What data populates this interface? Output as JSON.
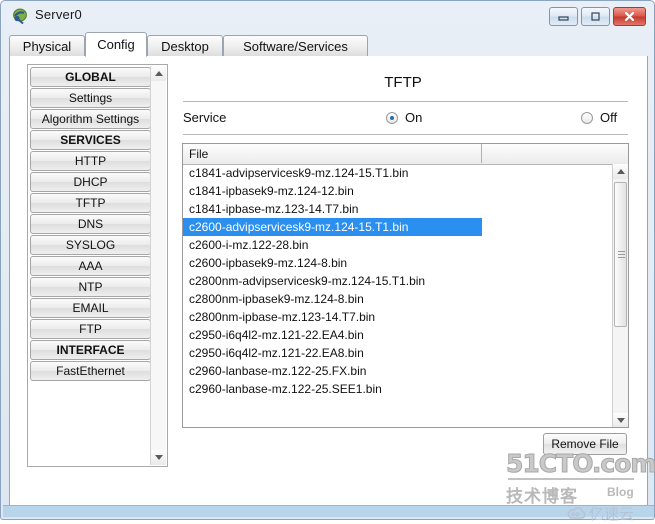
{
  "window": {
    "title": "Server0",
    "icon": "device-server-icon",
    "buttons": {
      "minimize": "minimize-icon",
      "maximize": "maximize-icon",
      "close": "close-icon"
    }
  },
  "tabs": [
    {
      "label": "Physical",
      "active": false
    },
    {
      "label": "Config",
      "active": true
    },
    {
      "label": "Desktop",
      "active": false
    },
    {
      "label": "Software/Services",
      "active": false
    }
  ],
  "sidebar": {
    "items": [
      {
        "label": "GLOBAL",
        "type": "header"
      },
      {
        "label": "Settings",
        "type": "item"
      },
      {
        "label": "Algorithm Settings",
        "type": "item"
      },
      {
        "label": "SERVICES",
        "type": "header"
      },
      {
        "label": "HTTP",
        "type": "item"
      },
      {
        "label": "DHCP",
        "type": "item"
      },
      {
        "label": "TFTP",
        "type": "item"
      },
      {
        "label": "DNS",
        "type": "item"
      },
      {
        "label": "SYSLOG",
        "type": "item"
      },
      {
        "label": "AAA",
        "type": "item"
      },
      {
        "label": "NTP",
        "type": "item"
      },
      {
        "label": "EMAIL",
        "type": "item"
      },
      {
        "label": "FTP",
        "type": "item"
      },
      {
        "label": "INTERFACE",
        "type": "header"
      },
      {
        "label": "FastEthernet",
        "type": "item"
      }
    ]
  },
  "main": {
    "title": "TFTP",
    "service": {
      "label": "Service",
      "on_label": "On",
      "off_label": "Off",
      "selected": "On"
    },
    "table": {
      "column_header": "File",
      "selected_index": 3,
      "rows": [
        "c1841-advipservicesk9-mz.124-15.T1.bin",
        "c1841-ipbasek9-mz.124-12.bin",
        "c1841-ipbase-mz.123-14.T7.bin",
        "c2600-advipservicesk9-mz.124-15.T1.bin",
        "c2600-i-mz.122-28.bin",
        "c2600-ipbasek9-mz.124-8.bin",
        "c2800nm-advipservicesk9-mz.124-15.T1.bin",
        "c2800nm-ipbasek9-mz.124-8.bin",
        "c2800nm-ipbase-mz.123-14.T7.bin",
        "c2950-i6q4l2-mz.121-22.EA4.bin",
        "c2950-i6q4l2-mz.121-22.EA8.bin",
        "c2960-lanbase-mz.122-25.FX.bin",
        "c2960-lanbase-mz.122-25.SEE1.bin"
      ]
    },
    "remove_button": "Remove File"
  },
  "watermark": {
    "site": "51CTO.com",
    "tagline": "技术博客",
    "blog": "Blog",
    "cloud": "亿速云"
  },
  "colors": {
    "selection": "#2a8fef",
    "radio_dot": "#2a6fb5",
    "frame_border": "#8aa4c0",
    "bottom_strip": "#b8d4ea"
  }
}
